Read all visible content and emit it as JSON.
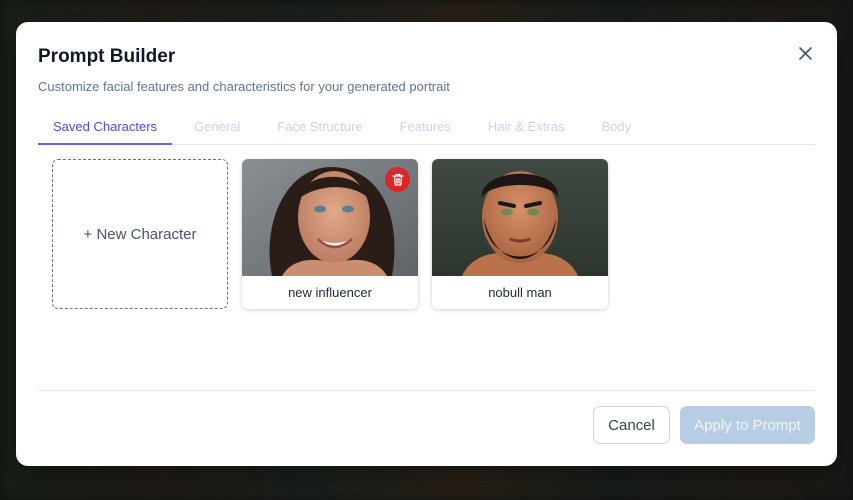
{
  "modal": {
    "title": "Prompt Builder",
    "subtitle": "Customize facial features and characteristics for your generated portrait",
    "close_icon": "close-icon"
  },
  "tabs": [
    {
      "label": "Saved Characters",
      "active": true
    },
    {
      "label": "General",
      "active": false
    },
    {
      "label": "Face Structure",
      "active": false
    },
    {
      "label": "Features",
      "active": false
    },
    {
      "label": "Hair & Extras",
      "active": false
    },
    {
      "label": "Body",
      "active": false
    }
  ],
  "new_character": {
    "label": "+ New Character"
  },
  "characters": [
    {
      "name": "new influencer",
      "delete_icon": "trash-icon"
    },
    {
      "name": "nobull man"
    }
  ],
  "footer": {
    "cancel_label": "Cancel",
    "apply_label": "Apply to Prompt"
  },
  "colors": {
    "accent": "#4f46e5",
    "delete": "#dc2626",
    "apply_disabled": "#b6cde4"
  }
}
